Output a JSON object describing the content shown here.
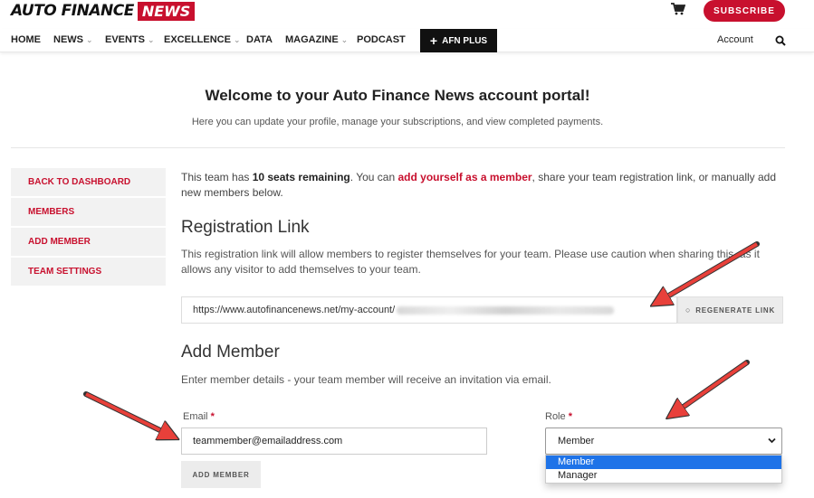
{
  "header": {
    "logo_main": "AUTO FINANCE",
    "logo_accent": "NEWS",
    "subscribe_label": "SUBSCRIBE",
    "brand_color": "#c8102e"
  },
  "nav": {
    "items": [
      {
        "label": "HOME",
        "has_dropdown": false
      },
      {
        "label": "NEWS",
        "has_dropdown": true
      },
      {
        "label": "EVENTS",
        "has_dropdown": true
      },
      {
        "label": "EXCELLENCE",
        "has_dropdown": true
      },
      {
        "label": "DATA",
        "has_dropdown": false
      },
      {
        "label": "MAGAZINE",
        "has_dropdown": true
      },
      {
        "label": "PODCAST",
        "has_dropdown": false
      }
    ],
    "plus_label": "AFN PLUS",
    "account_label": "Account",
    "chevron": "⌄"
  },
  "welcome": {
    "title": "Welcome to your Auto Finance News account portal!",
    "subtitle": "Here you can update your profile, manage your subscriptions, and view completed payments."
  },
  "sidebar": {
    "items": [
      {
        "label": "BACK TO DASHBOARD"
      },
      {
        "label": "MEMBERS"
      },
      {
        "label": "ADD MEMBER"
      },
      {
        "label": "TEAM SETTINGS"
      }
    ]
  },
  "team": {
    "seats_prefix": "This team has ",
    "seats_bold": "10 seats remaining",
    "seats_mid": ". You can ",
    "seats_link": "add yourself as a member",
    "seats_suffix": ", share your team registration link, or manually add new members below."
  },
  "registration": {
    "heading": "Registration Link",
    "description": "This registration link will allow members to register themselves for your team. Please use caution when sharing this, as it allows any visitor to add themselves to your team.",
    "link_value": "https://www.autofinancenews.net/my-account/",
    "regenerate_label": "REGENERATE LINK",
    "regenerate_icon": "○"
  },
  "add_member": {
    "heading": "Add Member",
    "description": "Enter member details - your team member will receive an invitation via email.",
    "email_label": "Email",
    "email_value": "teammember@emailaddress.com",
    "role_label": "Role",
    "role_value": "Member",
    "role_options": [
      "Member",
      "Manager"
    ],
    "required_mark": "*",
    "button_label": "ADD MEMBER"
  },
  "annotations": {
    "arrow_color": "#e8403a"
  }
}
